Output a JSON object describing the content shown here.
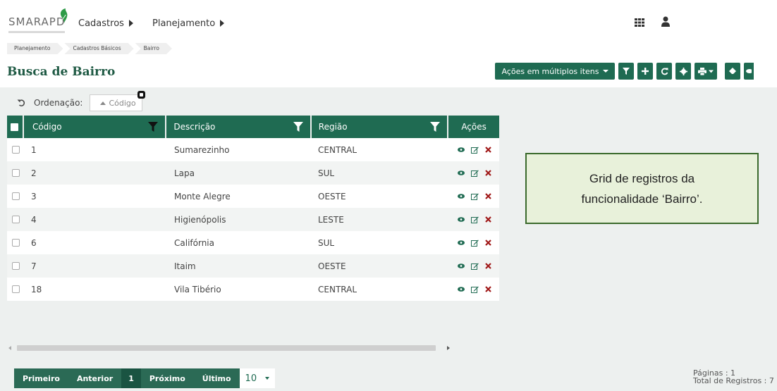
{
  "header": {
    "logo_text": "SMARAPD",
    "menu": [
      {
        "label": "Cadastros"
      },
      {
        "label": "Planejamento"
      }
    ]
  },
  "breadcrumb": [
    "Planejamento",
    "Cadastros Básicos",
    "Bairro"
  ],
  "page_title": "Busca de Bairro",
  "toolbar": {
    "bulk_actions_label": "Ações em múltiplos itens"
  },
  "sort": {
    "label": "Ordenação:",
    "chip": "Código"
  },
  "grid": {
    "columns": [
      "Código",
      "Descrição",
      "Região",
      "Ações"
    ],
    "rows": [
      {
        "codigo": "1",
        "descricao": "Sumarezinho",
        "regiao": "CENTRAL"
      },
      {
        "codigo": "2",
        "descricao": "Lapa",
        "regiao": "SUL"
      },
      {
        "codigo": "3",
        "descricao": "Monte Alegre",
        "regiao": "OESTE"
      },
      {
        "codigo": "4",
        "descricao": "Higienópolis",
        "regiao": "LESTE"
      },
      {
        "codigo": "6",
        "descricao": "Califórnia",
        "regiao": "SUL"
      },
      {
        "codigo": "7",
        "descricao": "Itaim",
        "regiao": "OESTE"
      },
      {
        "codigo": "18",
        "descricao": "Vila Tibério",
        "regiao": "CENTRAL"
      }
    ]
  },
  "pagination": {
    "first": "Primeiro",
    "prev": "Anterior",
    "current": "1",
    "next": "Próximo",
    "last": "Último",
    "page_size": "10",
    "pages_text": "Páginas : 1",
    "total_text": "Total de Registros : 7"
  },
  "annotation": {
    "line1": "Grid de registros da",
    "line2": "funcionalidade ‘Bairro’."
  },
  "colors": {
    "primary": "#1f6b52",
    "title": "#1f5a44",
    "delete": "#a01818",
    "note_bg": "#e8f1da"
  }
}
